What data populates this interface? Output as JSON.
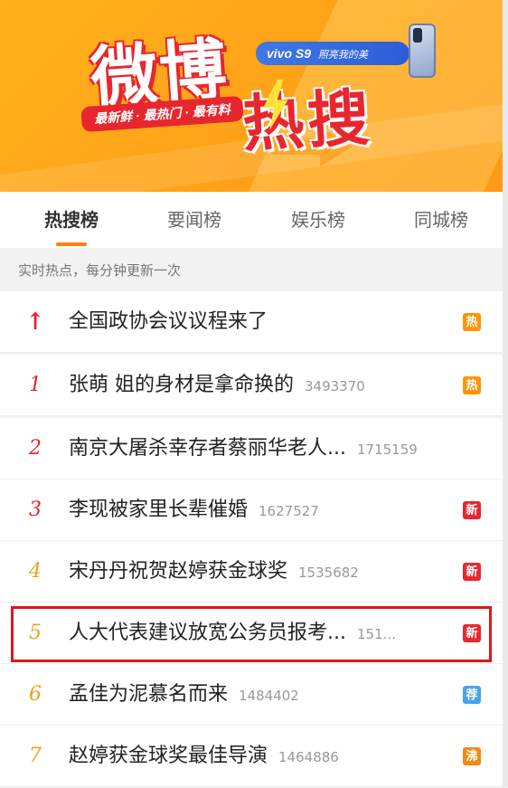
{
  "banner": {
    "title_main": "微博",
    "title_sub": "热搜",
    "slogan": "最新鲜 · 最热门 · 最有料",
    "ad_brand": "vivo S9",
    "ad_sub": "照亮我的美"
  },
  "tabs": [
    {
      "label": "热搜榜",
      "active": true
    },
    {
      "label": "要闻榜",
      "active": false
    },
    {
      "label": "娱乐榜",
      "active": false
    },
    {
      "label": "同城榜",
      "active": false
    }
  ],
  "subheader": "实时热点，每分钟更新一次",
  "colors": {
    "hot": "#ff9406",
    "new": "#e8262e",
    "recommend": "#4aa3ea",
    "boil": "#f48a14",
    "accent": "#ff8200"
  },
  "list": [
    {
      "rank": "↑",
      "title": "全国政协会议议程来了",
      "count": "",
      "badge": "热",
      "badge_type": "hot"
    },
    {
      "rank": "1",
      "title": "张萌 姐的身材是拿命换的",
      "count": "3493370",
      "badge": "热",
      "badge_type": "hot"
    },
    {
      "rank": "2",
      "title": "南京大屠杀幸存者蔡丽华老人...",
      "count": "1715159",
      "badge": "",
      "badge_type": ""
    },
    {
      "rank": "3",
      "title": "李现被家里长辈催婚",
      "count": "1627527",
      "badge": "新",
      "badge_type": "new"
    },
    {
      "rank": "4",
      "title": "宋丹丹祝贺赵婷获金球奖",
      "count": "1535682",
      "badge": "新",
      "badge_type": "new"
    },
    {
      "rank": "5",
      "title": "人大代表建议放宽公务员报考...",
      "count": "151...",
      "badge": "新",
      "badge_type": "new"
    },
    {
      "rank": "6",
      "title": "孟佳为泥慕名而来",
      "count": "1484402",
      "badge": "荐",
      "badge_type": "recommend"
    },
    {
      "rank": "7",
      "title": "赵婷获金球奖最佳导演",
      "count": "1464886",
      "badge": "沸",
      "badge_type": "boil"
    }
  ]
}
